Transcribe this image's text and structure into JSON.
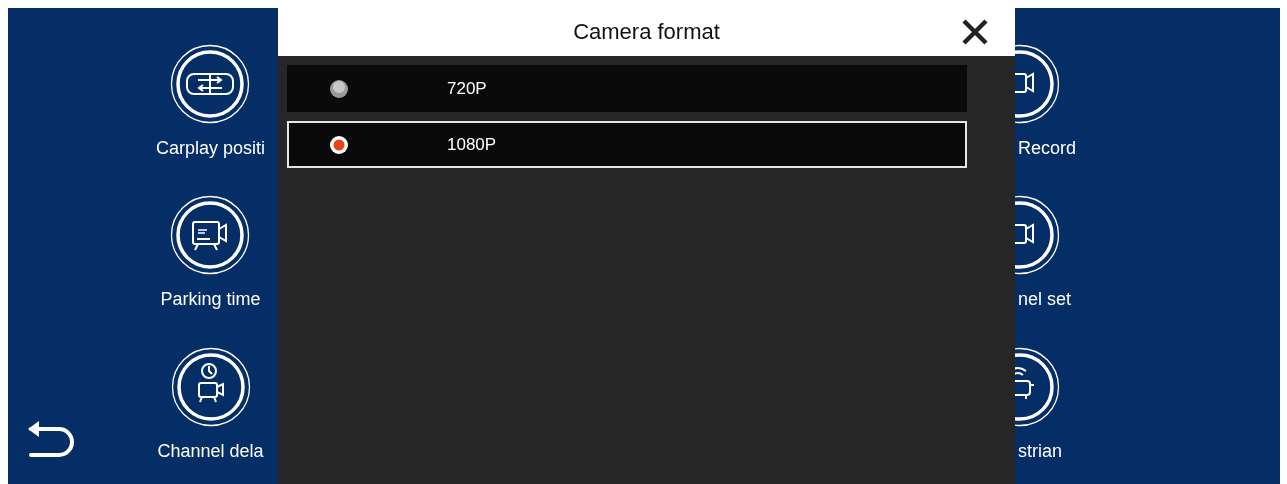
{
  "menu_left": [
    {
      "kind": "swap",
      "label": "Carplay positi"
    },
    {
      "kind": "time",
      "label": "Parking time"
    },
    {
      "kind": "delay",
      "label": "Channel dela"
    }
  ],
  "menu_right": [
    {
      "kind": "camera",
      "label": "Record"
    },
    {
      "kind": "camera",
      "label": "nel set"
    },
    {
      "kind": "car",
      "label": "strian"
    }
  ],
  "dialog": {
    "title": "Camera format",
    "options": [
      {
        "label": "720P",
        "selected": false
      },
      {
        "label": "1080P",
        "selected": true
      }
    ]
  }
}
